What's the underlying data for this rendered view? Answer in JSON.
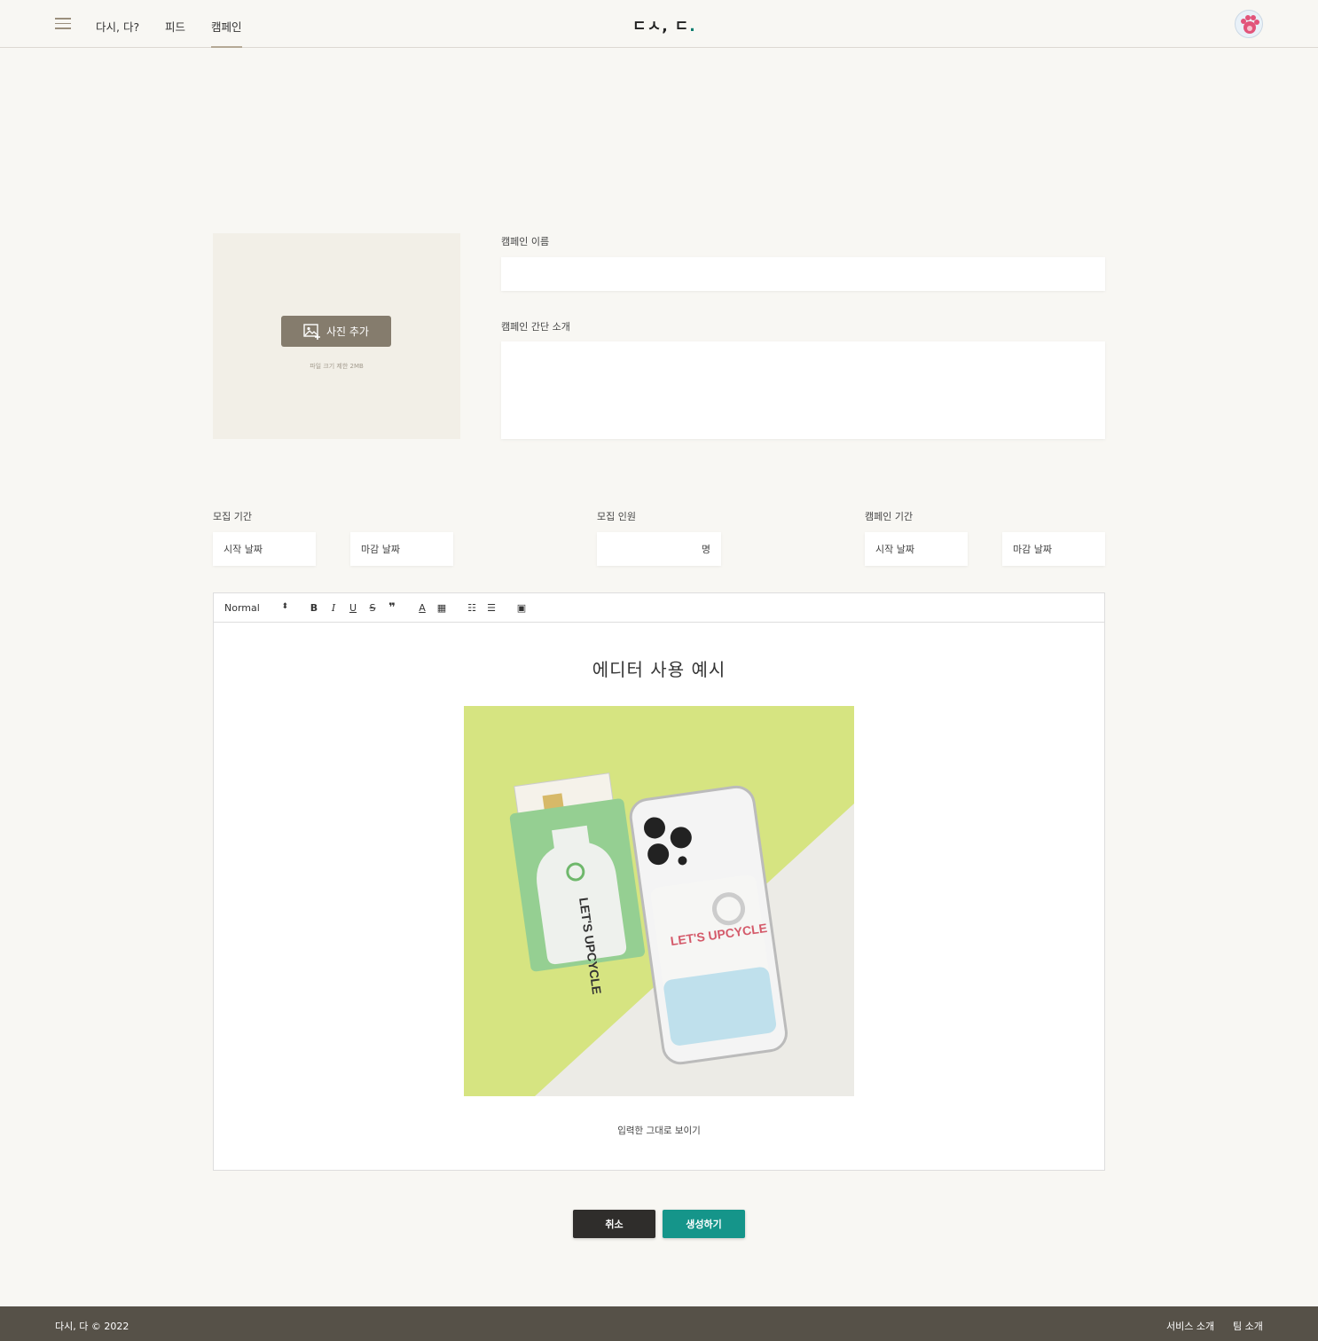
{
  "header": {
    "nav": [
      "다시, 다?",
      "피드",
      "캠페인"
    ],
    "logo_main": "ㄷㅅ, ㄷ",
    "logo_dot": "."
  },
  "photo": {
    "button_label": "사진 추가",
    "hint": "파일 크기 제한 2MB"
  },
  "form": {
    "name_label": "캠페인 이름",
    "name_value": "",
    "intro_label": "캠페인 간단 소개",
    "intro_value": "",
    "recruit_period_label": "모집 기간",
    "recruit_start": "시작 날짜",
    "recruit_end": "마감 날짜",
    "recruit_count_label": "모집 인원",
    "recruit_count_unit": "명",
    "campaign_period_label": "캠페인 기간",
    "campaign_start": "시작 날짜",
    "campaign_end": "마감 날짜"
  },
  "editor": {
    "format_select": "Normal",
    "title": "에디터 사용 예시",
    "caption": "입력한 그대로 보이기",
    "image_texts": {
      "card_left": "LET'S UPCYCLE",
      "card_right": "LET'S UPCYCLE"
    }
  },
  "actions": {
    "cancel": "취소",
    "create": "생성하기"
  },
  "footer": {
    "copyright": "다시, 다 © 2022",
    "service_link": "서비스 소개",
    "team_link": "팀 소개"
  },
  "colors": {
    "accent_green": "#15958a",
    "photo_button": "#857c6d",
    "footer_bg": "#565148",
    "page_bg": "#f8f7f3"
  }
}
